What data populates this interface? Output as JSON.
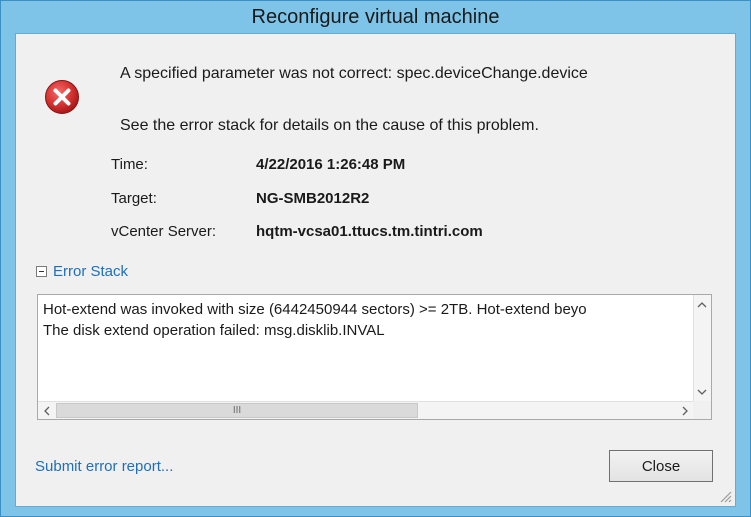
{
  "window": {
    "title": "Reconfigure virtual machine"
  },
  "error": {
    "icon": "error-x-icon",
    "message": "A specified parameter was not correct: spec.deviceChange.device",
    "hint": "See the error stack for details on the cause of this problem."
  },
  "details": {
    "time_label": "Time:",
    "time_value": "4/22/2016 1:26:48 PM",
    "target_label": "Target:",
    "target_value": "NG-SMB2012R2",
    "vcenter_label": "vCenter Server:",
    "vcenter_value": "hqtm-vcsa01.ttucs.tm.tintri.com"
  },
  "error_stack": {
    "label": "Error Stack",
    "lines": [
      "Hot-extend was invoked with size (6442450944 sectors) >= 2TB. Hot-extend beyo",
      "The disk extend operation failed: msg.disklib.INVAL"
    ],
    "scrollbar_thumb_glyph": "III"
  },
  "footer": {
    "submit_link": "Submit error report...",
    "close_button": "Close"
  },
  "colors": {
    "frame": "#7ec3e8",
    "link": "#1f6fb8",
    "error_red": "#d32f2f"
  }
}
